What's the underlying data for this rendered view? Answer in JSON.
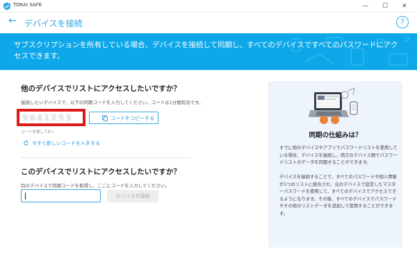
{
  "app": {
    "name": "TOKAI SAFE"
  },
  "window": {
    "minimize": "—",
    "maximize": "☐",
    "close": "✕"
  },
  "header": {
    "back": "←",
    "title": "デバイスを接続",
    "help": "?"
  },
  "banner": {
    "text": "サブスクリプションを所有している場合、デバイスを接続して同期し、すべてのデバイスですべてのパスワードにアクセスできます。"
  },
  "other_device": {
    "heading": "他のデバイスでリストにアクセスしたいですか？",
    "instruction": "接続したいデバイスで、以下の同期コードを入力してください。コードは1分間有効です。",
    "code": "9041253",
    "copy_label": "コードをコピーする",
    "hint": "コードを残しておく",
    "refresh_label": "今すぐ新しいコードを入手する"
  },
  "this_device": {
    "heading": "このデバイスでリストにアクセスしたいですか？",
    "instruction": "別のデバイスで同期コードを取得し、ここにコードを入力してください。",
    "input_value": "",
    "connect_label": "デバイスを接続"
  },
  "info": {
    "heading": "同期の仕組みは？",
    "paragraph1": "すでに他のデバイスやアプリでパスワードリストを使用している場合、デバイスを接続し、両方のデバイス間でパスワードリストのデータを同期することができます。",
    "paragraph2": "デバイスを接続することで、すべてのパスワードや個人情報が1つのリストに統合され、元のデバイスで設定したマスターパスワードを使用して、すべてのデバイスでアクセスできるようになります。その後、すべてのデバイスでパスワードやその他のリストデータを追加して使用することができます。"
  },
  "colors": {
    "accent": "#0ea8ea",
    "highlight": "#e01818",
    "panel": "#eef4fb"
  }
}
